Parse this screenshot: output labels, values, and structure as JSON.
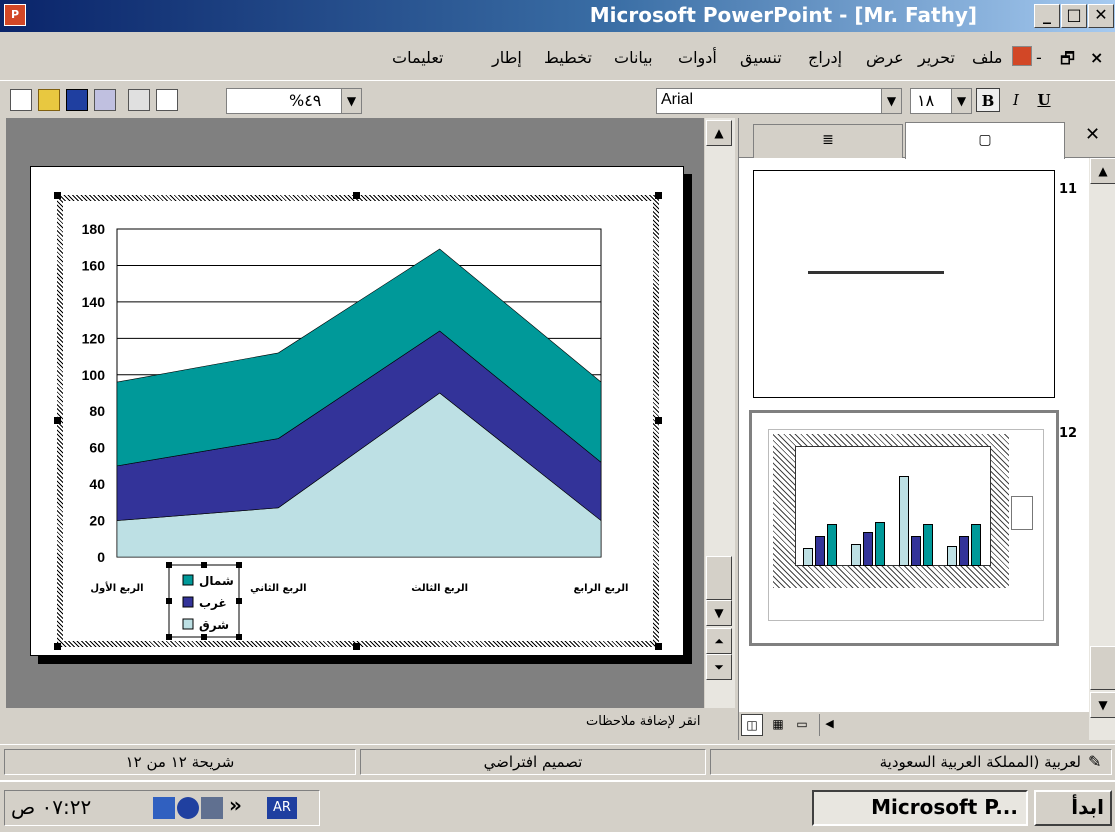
{
  "window": {
    "title": "Microsoft PowerPoint - [Mr. Fathy]",
    "minimize_glyph": "_",
    "maximize_glyph": "□",
    "close_glyph": "✕"
  },
  "menu": {
    "items": [
      "ملف",
      "تحرير",
      "عرض",
      "إدراج",
      "تنسيق",
      "أدوات",
      "بيانات",
      "تخطيط",
      "إطار",
      "تعليمات"
    ],
    "doc_close": "×",
    "doc_restore": "🗗"
  },
  "toolbar": {
    "zoom": "%٤٩",
    "font": "Arial",
    "font_size": "١٨",
    "bold": "B",
    "italic": "I",
    "underline": "U"
  },
  "chart_data": {
    "type": "area",
    "stacked": true,
    "categories": [
      "الربع الأول",
      "الربع الثاني",
      "الربع الثالث",
      "الربع الرابع"
    ],
    "series": [
      {
        "name": "شرق",
        "values": [
          20,
          27,
          90,
          20
        ],
        "color": "#bde0e4"
      },
      {
        "name": "غرب",
        "values": [
          30,
          38,
          34,
          32
        ],
        "color": "#333399"
      },
      {
        "name": "شمال",
        "values": [
          46,
          47,
          45,
          44
        ],
        "color": "#009999"
      }
    ],
    "ylim": [
      0,
      180
    ],
    "yticks": [
      "0",
      "20",
      "40",
      "60",
      "80",
      "100",
      "120",
      "140",
      "160",
      "180"
    ],
    "grid": true,
    "legend": "bottom-left"
  },
  "thumbnails": [
    {
      "number": "11"
    },
    {
      "number": "12"
    }
  ],
  "notes": {
    "placeholder": "انقر لإضافة ملاحظات"
  },
  "status": {
    "slide": "شريحة ١٢ من ١٢",
    "design": "تصميم افتراضي",
    "language": "لعربية (المملكة العربية السعودية"
  },
  "taskbar": {
    "start": "ابدأ",
    "app": "Microsoft P...",
    "lang": "AR",
    "clock": "٠٧:٢٢ ص",
    "chevron": "»"
  },
  "colors": {
    "title_gradient_start": "#0a246a",
    "title_gradient_end": "#a6caf0",
    "east": "#bde0e4",
    "west": "#333399",
    "north": "#009999"
  }
}
